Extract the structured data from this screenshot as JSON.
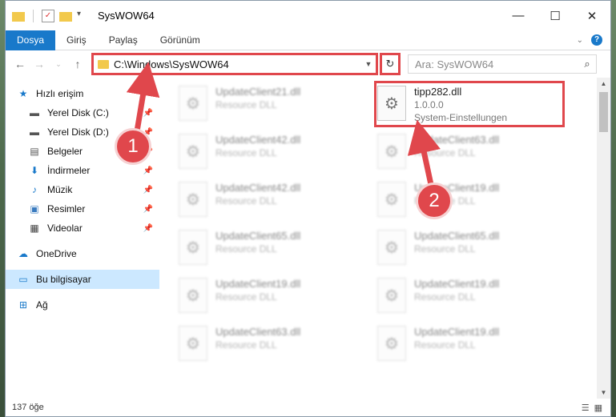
{
  "window": {
    "title": "SysWOW64",
    "controls": {
      "minimize": "—",
      "maximize": "☐",
      "close": "✕"
    }
  },
  "ribbon": {
    "tabs": [
      "Dosya",
      "Giriş",
      "Paylaş",
      "Görünüm"
    ]
  },
  "address": {
    "path": "C:\\Windows\\SysWOW64",
    "search_placeholder": "Ara: SysWOW64"
  },
  "sidebar": {
    "quick_access": "Hızlı erişim",
    "pinned": [
      {
        "label": "Yerel Disk (C:)",
        "icon": "drive-icon"
      },
      {
        "label": "Yerel Disk (D:)",
        "icon": "drive-icon"
      },
      {
        "label": "Belgeler",
        "icon": "documents-icon"
      },
      {
        "label": "İndirmeler",
        "icon": "download-icon"
      },
      {
        "label": "Müzik",
        "icon": "music-icon"
      },
      {
        "label": "Resimler",
        "icon": "pictures-icon"
      },
      {
        "label": "Videolar",
        "icon": "videos-icon"
      }
    ],
    "onedrive": "OneDrive",
    "this_pc": "Bu bilgisayar",
    "network": "Ağ"
  },
  "files_left": [
    {
      "name": "UpdateClient21.dll",
      "type": "Resource DLL"
    },
    {
      "name": "UpdateClient42.dll",
      "type": "Resource DLL"
    },
    {
      "name": "UpdateClient42.dll",
      "type": "Resource DLL"
    },
    {
      "name": "UpdateClient65.dll",
      "type": "Resource DLL"
    },
    {
      "name": "UpdateClient19.dll",
      "type": "Resource DLL"
    },
    {
      "name": "UpdateClient63.dll",
      "type": "Resource DLL"
    }
  ],
  "files_right": [
    {
      "name": "tipp282.dll",
      "type": "1.0.0.0",
      "extra": "System-Einstellungen"
    },
    {
      "name": "UpdateClient63.dll",
      "type": "Resource DLL"
    },
    {
      "name": "UpdateClient19.dll",
      "type": "Resource DLL"
    },
    {
      "name": "UpdateClient65.dll",
      "type": "Resource DLL"
    },
    {
      "name": "UpdateClient19.dll",
      "type": "Resource DLL"
    },
    {
      "name": "UpdateClient19.dll",
      "type": "Resource DLL"
    }
  ],
  "status": {
    "count": "137 öğe"
  },
  "callouts": [
    "1",
    "2"
  ],
  "colors": {
    "accent": "#1979ca",
    "highlight": "#e0474c",
    "selected": "#cce8ff"
  }
}
